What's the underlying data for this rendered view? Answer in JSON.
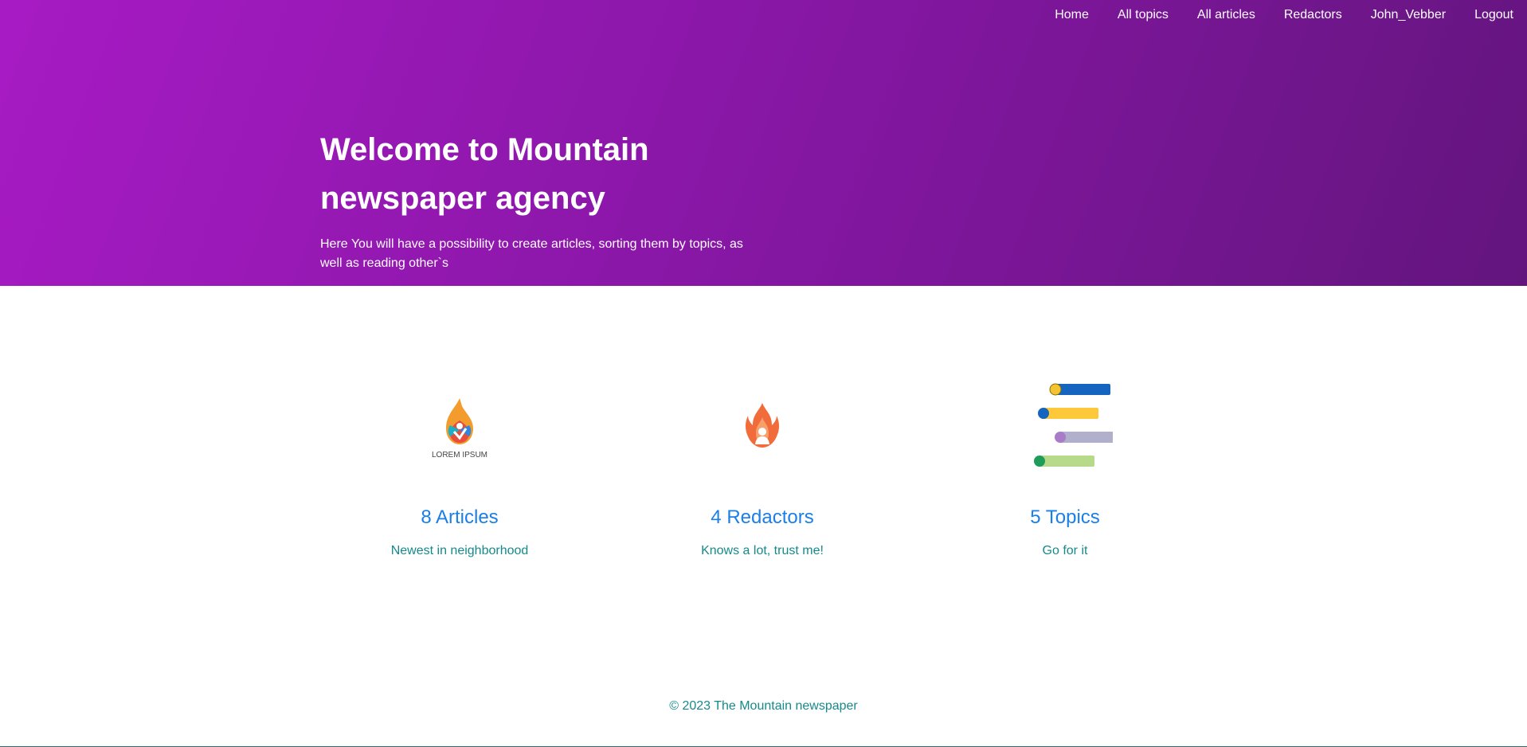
{
  "nav": {
    "items": [
      {
        "label": "Home"
      },
      {
        "label": "All topics"
      },
      {
        "label": "All articles"
      },
      {
        "label": "Redactors"
      },
      {
        "label": "John_Vebber"
      },
      {
        "label": "Logout"
      }
    ]
  },
  "hero": {
    "title": "Welcome to Mountain newspaper agency",
    "subtitle": "Here You will have a possibility to create articles, sorting them by topics, as well as reading other`s"
  },
  "features": [
    {
      "logo_text": "LOREM IPSUM",
      "title": "8 Articles",
      "subtitle": "Newest in neighborhood",
      "icon": "flame-drop-logo-icon"
    },
    {
      "title": "4 Redactors",
      "subtitle": "Knows a lot, trust me!",
      "icon": "fire-person-icon"
    },
    {
      "title": "5 Topics",
      "subtitle": "Go for it",
      "icon": "toggle-list-icon"
    }
  ],
  "footer": {
    "text": "© 2023 The Mountain newspaper"
  },
  "colors": {
    "hero_gradient_start": "#a71bc4",
    "hero_gradient_end": "#63157e",
    "feature_title": "#1a7fe6",
    "feature_subtitle": "#168a8a"
  }
}
